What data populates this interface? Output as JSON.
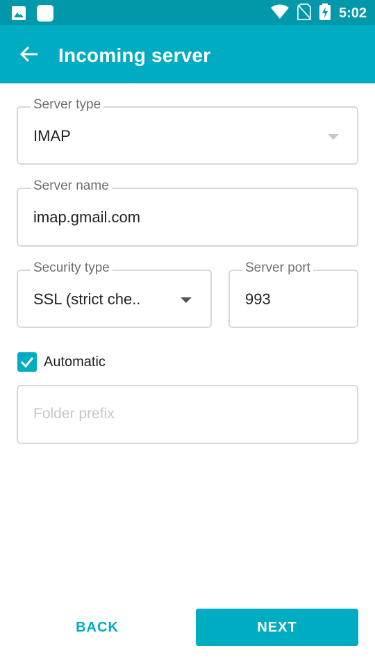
{
  "status_bar": {
    "time": "5:02",
    "icons": [
      "image-icon",
      "square-app-icon",
      "wifi-icon",
      "no-sim-icon",
      "battery-charging-icon"
    ]
  },
  "app_bar": {
    "title": "Incoming server",
    "back_icon": "arrow-left-icon"
  },
  "form": {
    "server_type": {
      "label": "Server type",
      "value": "IMAP"
    },
    "server_name": {
      "label": "Server name",
      "value": "imap.gmail.com"
    },
    "security_type": {
      "label": "Security type",
      "value": "SSL (strict che.."
    },
    "server_port": {
      "label": "Server port",
      "value": "993"
    },
    "automatic": {
      "label": "Automatic",
      "checked": true
    },
    "folder_prefix": {
      "placeholder": "Folder prefix",
      "value": ""
    }
  },
  "actions": {
    "back_label": "BACK",
    "next_label": "NEXT"
  },
  "colors": {
    "status_bar": "#0198AC",
    "app_bar": "#00ACC1",
    "accent": "#00ACC1",
    "field_border": "#d8d8d8"
  }
}
